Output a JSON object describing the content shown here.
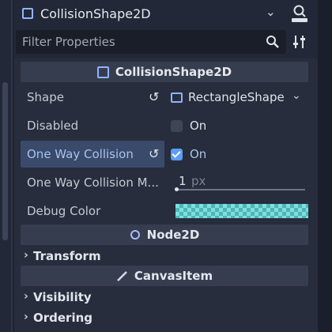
{
  "header": {
    "title": "CollisionShape2D",
    "chevron": "⌄",
    "doc_icon": "doc-search-icon"
  },
  "filter": {
    "placeholder": "Filter Properties"
  },
  "sections": {
    "collision_shape": "CollisionShape2D",
    "node2d": "Node2D",
    "canvas_item": "CanvasItem"
  },
  "properties": {
    "shape": {
      "label": "Shape",
      "value": "RectangleShape"
    },
    "disabled": {
      "label": "Disabled",
      "value": "On",
      "checked": false
    },
    "one_way": {
      "label": "One Way Collision",
      "value": "On",
      "checked": true
    },
    "one_way_margin": {
      "label": "One Way Collision M...",
      "value": "1",
      "unit": "px"
    },
    "debug_color": {
      "label": "Debug Color",
      "swatch": "#7fdfe0"
    }
  },
  "groups": {
    "transform": "Transform",
    "visibility": "Visibility",
    "ordering": "Ordering"
  },
  "colors": {
    "accent": "#5c9cf5",
    "highlight": "#3a4a6a",
    "node2d": "#8fb4ff"
  }
}
